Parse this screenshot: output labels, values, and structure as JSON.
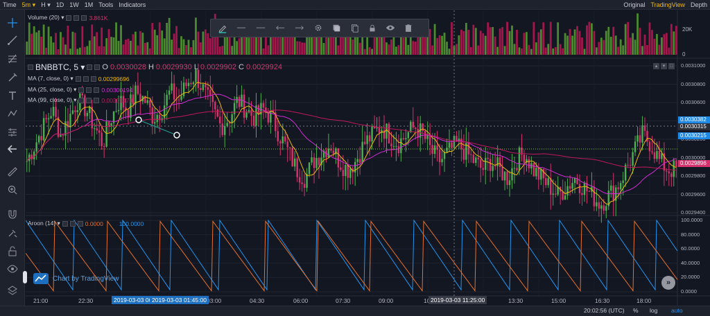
{
  "topbar": {
    "left": [
      {
        "name": "tb-time",
        "label": "Time",
        "active": false
      },
      {
        "name": "tb-5m",
        "label": "5m ▾",
        "active": true
      },
      {
        "name": "tb-h",
        "label": "H ▾",
        "active": false
      },
      {
        "name": "tb-1d",
        "label": "1D",
        "active": false
      },
      {
        "name": "tb-1w",
        "label": "1W",
        "active": false
      },
      {
        "name": "tb-1m",
        "label": "1M",
        "active": false
      },
      {
        "name": "tb-tools",
        "label": "Tools",
        "active": false
      },
      {
        "name": "tb-indicators",
        "label": "Indicators",
        "active": false
      }
    ],
    "right": [
      {
        "name": "tb-original",
        "label": "Original",
        "active": false
      },
      {
        "name": "tb-tradingview",
        "label": "TradingView",
        "active": true
      },
      {
        "name": "tb-depth",
        "label": "Depth",
        "active": false
      }
    ]
  },
  "left_tools": [
    "crosshair-icon",
    "trendline-icon",
    "fib-icon",
    "brush-icon",
    "text-icon",
    "pattern-icon",
    "measure-icon",
    "back-arrow-icon",
    "ruler-icon",
    "zoom-icon",
    "magnet-icon",
    "lock-draw-icon",
    "unlock-icon",
    "eye-icon",
    "layers-icon",
    "collapse-icon"
  ],
  "draw_toolbar": [
    "pencil-icon",
    "line-style-1-icon",
    "line-style-2-icon",
    "arrow-left-line-icon",
    "arrow-right-line-icon",
    "settings-icon",
    "clone-icon",
    "copy-icon",
    "lock-icon",
    "visibility-icon",
    "trash-icon"
  ],
  "volume_legend": {
    "label": "Volume (20) ▾",
    "value": "3.861K",
    "axis": [
      "20K",
      "0"
    ]
  },
  "symbol_legend": {
    "symbol": "BNBBTC, 5 ▾",
    "open_k": "O",
    "open_v": "0.0030028",
    "high_k": "H",
    "high_v": "0.0029930",
    "low_k": "L",
    "low_v": "0.0029902",
    "close_k": "C",
    "close_v": "0.0029924"
  },
  "ma_legends": [
    {
      "label": "MA (7, close, 0) ▾",
      "value": "0.00299696",
      "color": "#f0b90b"
    },
    {
      "label": "MA (25, close, 0) ▾",
      "value": "0.00300194",
      "color": "#d42cd6"
    },
    {
      "label": "MA (99, close, 0) ▾",
      "value": "0.00301478",
      "color": "#c2185b"
    }
  ],
  "aroon_legend": {
    "label": "Aroon (14) ▾",
    "down": "0.0000",
    "up": "100.0000",
    "down_color": "#e8712c",
    "up_color": "#2196f3"
  },
  "price_axis": [
    "0.0031000",
    "0.0030800",
    "0.0030600",
    "0.0030400",
    "0.0030200",
    "0.0030000",
    "0.0029800",
    "0.0029600",
    "0.0029400"
  ],
  "price_tags": [
    {
      "value": "0.0030382",
      "color": "#1e88e5"
    },
    {
      "value": "0.0030315",
      "color": "#2a2e39"
    },
    {
      "value": "0.0030215",
      "color": "#1e88e5"
    },
    {
      "value": "0.0029896",
      "color": "#d6336c"
    }
  ],
  "aroon_axis": [
    "100.0000",
    "80.0000",
    "60.0000",
    "40.0000",
    "20.0000",
    "0.0000"
  ],
  "time_axis": [
    "21:00",
    "22:30",
    "03:00",
    "04:30",
    "06:00",
    "07:30",
    "09:00",
    "10",
    "13:30",
    "15:00",
    "16:30",
    "18:00"
  ],
  "time_highlights": [
    "2019-03-03 00",
    "2019-03-03 01:45:00",
    "2019-03-03 11:25:00"
  ],
  "watermark": "Chart by TradingView",
  "bottom": {
    "clock": "20:02:56 (UTC)",
    "percent": "%",
    "log": "log",
    "auto": "auto"
  },
  "colors": {
    "up": "#4caf50",
    "down": "#d6336c",
    "bg": "#131722"
  },
  "chart_data": {
    "type": "candlestick",
    "symbol": "BNBBTC",
    "interval": "5",
    "ylim": [
      0.00294,
      0.00311
    ],
    "closes": [
      0.003,
      0.00302,
      0.00304,
      0.00306,
      0.00303,
      0.00305,
      0.00307,
      0.00306,
      0.00304,
      0.00302,
      0.00305,
      0.00307,
      0.00306,
      0.00308,
      0.00307,
      0.00305,
      0.00306,
      0.00308,
      0.00307,
      0.00309,
      0.0031,
      0.00308,
      0.00306,
      0.00304,
      0.00305,
      0.00307,
      0.00306,
      0.00305,
      0.00306,
      0.00305,
      0.00303,
      0.00301,
      0.00299,
      0.00298,
      0.003,
      0.00301,
      0.00302,
      0.003,
      0.00299,
      0.003,
      0.00302,
      0.00303,
      0.00304,
      0.00303,
      0.00302,
      0.00303,
      0.00304,
      0.00303,
      0.00301,
      0.003,
      0.00301,
      0.00302,
      0.00301,
      0.003,
      0.00299,
      0.003,
      0.00299,
      0.00298,
      0.003,
      0.00301,
      0.00299,
      0.00298,
      0.00297,
      0.00296,
      0.00297,
      0.00298,
      0.00297,
      0.00296,
      0.00295,
      0.00296,
      0.00297,
      0.00299,
      0.00301,
      0.00303,
      0.00302,
      0.003,
      0.00299,
      0.00299
    ],
    "aroon_up_peaks": [
      100,
      100,
      100,
      100,
      100,
      100,
      100,
      100,
      100,
      100,
      100,
      100,
      100
    ],
    "aroon_down_peaks": [
      100,
      100,
      100,
      100,
      100,
      100,
      100,
      100,
      100,
      100,
      100,
      100
    ]
  }
}
